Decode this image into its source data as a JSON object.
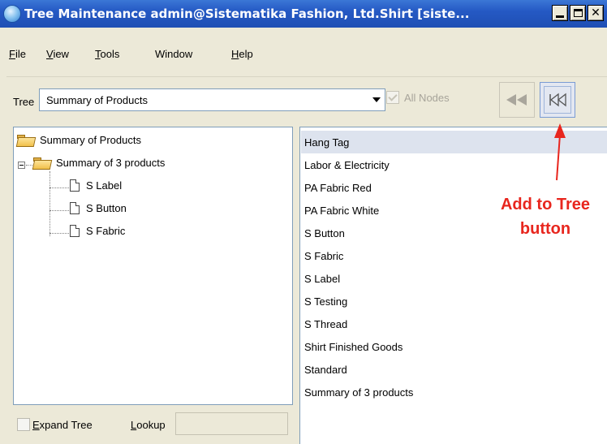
{
  "window": {
    "title": "Tree Maintenance  admin@Sistematika Fashion, Ltd.Shirt [siste..."
  },
  "menu": {
    "file": {
      "u": "F",
      "rest": "ile"
    },
    "view": {
      "u": "V",
      "rest": "iew"
    },
    "tools": {
      "u": "T",
      "rest": "ools"
    },
    "window": {
      "u": "",
      "rest": "Window"
    },
    "help": {
      "u": "H",
      "rest": "elp"
    }
  },
  "toolbar": {
    "tree_label": "Tree",
    "tree_value": "Summary of Products",
    "all_nodes_label": "All Nodes",
    "all_nodes_checked": true,
    "all_nodes_enabled": false,
    "rewind_icon": "rewind-icon",
    "add_to_tree_icon": "skip-to-start-icon"
  },
  "tree": {
    "root": "Summary of Products",
    "child": "Summary of 3 products",
    "leaves": [
      "S Label",
      "S Button",
      "S Fabric"
    ]
  },
  "bottom": {
    "expand_u": "E",
    "expand_rest": "xpand Tree",
    "lookup_u": "L",
    "lookup_rest": "ookup",
    "expand_checked": false,
    "lookup_value": ""
  },
  "list": {
    "items": [
      "Hang Tag",
      "Labor & Electricity",
      "PA Fabric Red",
      "PA Fabric White",
      "S Button",
      "S Fabric",
      "S Label",
      "S Testing",
      "S Thread",
      "Shirt Finished Goods",
      "Standard",
      "Summary of 3 products"
    ],
    "selected_index": 0
  },
  "annotation": {
    "line1": "Add to Tree",
    "line2": "button",
    "color": "#e8261e"
  },
  "colors": {
    "titlebar": "#2559c4",
    "selection": "#dde3ee",
    "border": "#7f9db9"
  }
}
